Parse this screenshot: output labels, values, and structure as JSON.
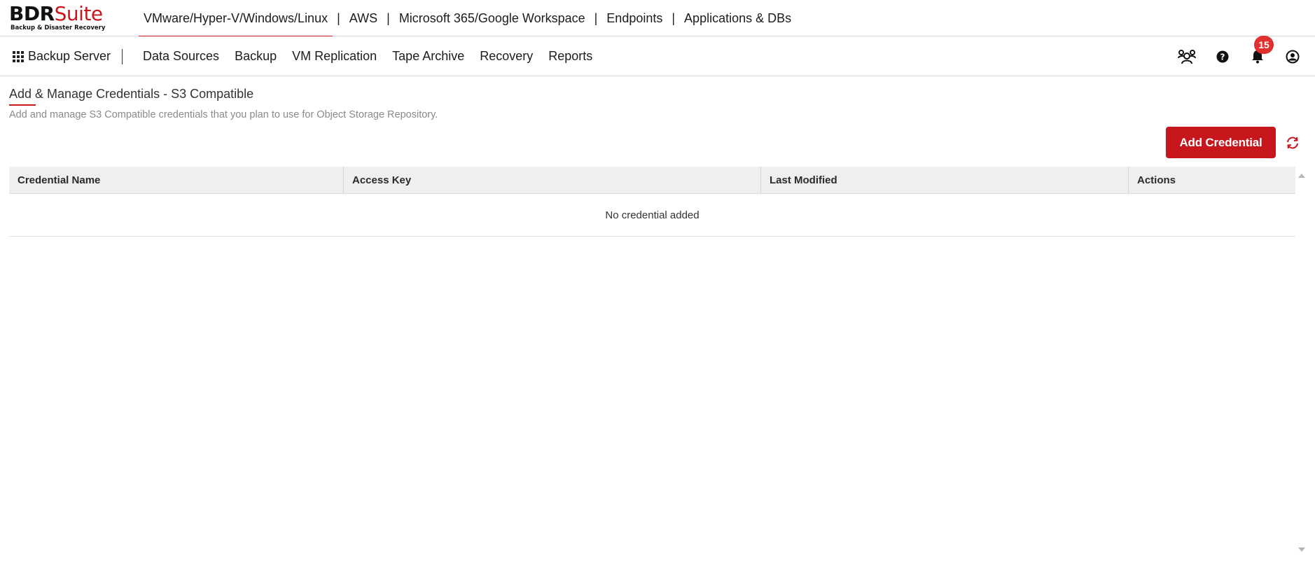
{
  "logo": {
    "brand_main": "BDR",
    "brand_accent": "Suite",
    "tagline": "Backup & Disaster Recovery"
  },
  "product_tabs": [
    {
      "label": "VMware/Hyper-V/Windows/Linux",
      "active": true
    },
    {
      "label": "AWS",
      "active": false
    },
    {
      "label": "Microsoft 365/Google Workspace",
      "active": false
    },
    {
      "label": "Endpoints",
      "active": false
    },
    {
      "label": "Applications & DBs",
      "active": false
    }
  ],
  "tab_separator": "|",
  "navbar": {
    "apps_label": "Backup Server",
    "items": [
      "Data Sources",
      "Backup",
      "VM Replication",
      "Tape Archive",
      "Recovery",
      "Reports"
    ],
    "icons": [
      "users-icon",
      "help-icon",
      "bell-icon",
      "user-icon"
    ],
    "notification_count": "15"
  },
  "page": {
    "title": "Add & Manage Credentials - S3 Compatible",
    "description": "Add and manage S3 Compatible credentials that you plan to use for Object Storage Repository.",
    "add_button_label": "Add Credential"
  },
  "table": {
    "columns": [
      "Credential Name",
      "Access Key",
      "Last Modified",
      "Actions"
    ],
    "empty_text": "No credential added"
  },
  "colors": {
    "accent": "#c8161d",
    "badge": "#e0302f",
    "header_bg": "#efefef"
  }
}
